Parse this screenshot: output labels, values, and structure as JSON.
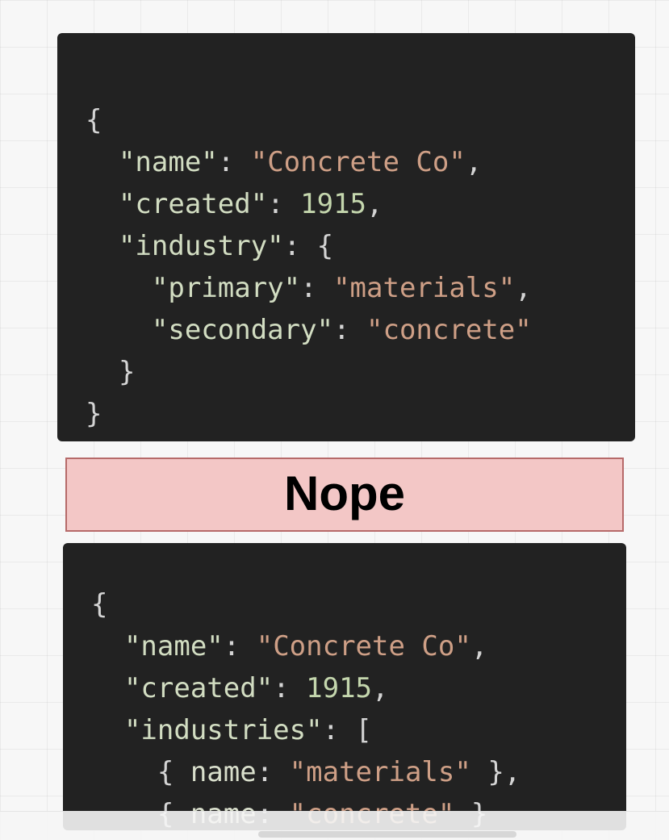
{
  "top_code": {
    "lines": [
      [
        {
          "t": "{",
          "c": "punc"
        }
      ],
      [
        {
          "t": "  ",
          "c": "punc"
        },
        {
          "t": "\"name\"",
          "c": "key"
        },
        {
          "t": ": ",
          "c": "punc"
        },
        {
          "t": "\"Concrete Co\"",
          "c": "str"
        },
        {
          "t": ",",
          "c": "punc"
        }
      ],
      [
        {
          "t": "  ",
          "c": "punc"
        },
        {
          "t": "\"created\"",
          "c": "key"
        },
        {
          "t": ": ",
          "c": "punc"
        },
        {
          "t": "1915",
          "c": "num"
        },
        {
          "t": ",",
          "c": "punc"
        }
      ],
      [
        {
          "t": "  ",
          "c": "punc"
        },
        {
          "t": "\"industry\"",
          "c": "key"
        },
        {
          "t": ": {",
          "c": "punc"
        }
      ],
      [
        {
          "t": "    ",
          "c": "punc"
        },
        {
          "t": "\"primary\"",
          "c": "key"
        },
        {
          "t": ": ",
          "c": "punc"
        },
        {
          "t": "\"materials\"",
          "c": "str"
        },
        {
          "t": ",",
          "c": "punc"
        }
      ],
      [
        {
          "t": "    ",
          "c": "punc"
        },
        {
          "t": "\"secondary\"",
          "c": "key"
        },
        {
          "t": ": ",
          "c": "punc"
        },
        {
          "t": "\"concrete\"",
          "c": "str"
        }
      ],
      [
        {
          "t": "  }",
          "c": "punc"
        }
      ],
      [
        {
          "t": "}",
          "c": "punc"
        }
      ]
    ]
  },
  "verdict": {
    "label": "Nope"
  },
  "bottom_code": {
    "lines": [
      [
        {
          "t": "{",
          "c": "punc"
        }
      ],
      [
        {
          "t": "  ",
          "c": "punc"
        },
        {
          "t": "\"name\"",
          "c": "key"
        },
        {
          "t": ": ",
          "c": "punc"
        },
        {
          "t": "\"Concrete Co\"",
          "c": "str"
        },
        {
          "t": ",",
          "c": "punc"
        }
      ],
      [
        {
          "t": "  ",
          "c": "punc"
        },
        {
          "t": "\"created\"",
          "c": "key"
        },
        {
          "t": ": ",
          "c": "punc"
        },
        {
          "t": "1915",
          "c": "num"
        },
        {
          "t": ",",
          "c": "punc"
        }
      ],
      [
        {
          "t": "  ",
          "c": "punc"
        },
        {
          "t": "\"industries\"",
          "c": "key"
        },
        {
          "t": ": [",
          "c": "punc"
        }
      ],
      [
        {
          "t": "    { ",
          "c": "punc"
        },
        {
          "t": "name",
          "c": "plain"
        },
        {
          "t": ": ",
          "c": "punc"
        },
        {
          "t": "\"materials\"",
          "c": "str"
        },
        {
          "t": " },",
          "c": "punc"
        }
      ],
      [
        {
          "t": "    { ",
          "c": "punc"
        },
        {
          "t": "name",
          "c": "plain"
        },
        {
          "t": ": ",
          "c": "punc"
        },
        {
          "t": "\"concrete\"",
          "c": "str"
        },
        {
          "t": " }",
          "c": "punc"
        }
      ]
    ]
  }
}
